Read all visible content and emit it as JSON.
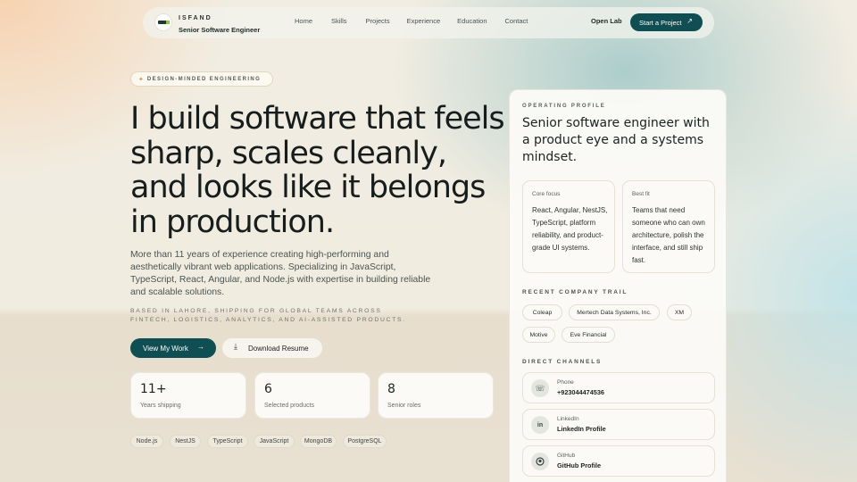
{
  "nav": {
    "brand_name": "ISFAND",
    "brand_subtitle": "Senior Software Engineer",
    "links": [
      "Home",
      "Skills",
      "Projects",
      "Experience",
      "Education",
      "Contact"
    ],
    "open_lab": "Open Lab",
    "cta": "Start a Project"
  },
  "hero": {
    "badge": "DESIGN-MINDED ENGINEERING",
    "headline": "I build software that feels sharp, scales cleanly, and looks like it belongs in production.",
    "lead": "More than 11 years of experience creating high-performing and aesthetically vibrant web applications. Specializing in JavaScript, TypeScript, React, Angular, and Node.js with expertise in building reliable and scalable solutions.",
    "based": "BASED IN LAHORE, SHIPPING FOR GLOBAL TEAMS ACROSS FINTECH, LOGISTICS, ANALYTICS, AND AI-ASSISTED PRODUCTS.",
    "primary_button": "View My Work",
    "secondary_button": "Download Resume",
    "stats": [
      {
        "value": "11+",
        "label": "Years shipping"
      },
      {
        "value": "6",
        "label": "Selected products"
      },
      {
        "value": "8",
        "label": "Senior roles"
      }
    ],
    "tech": [
      "Node.js",
      "NestJS",
      "TypeScript",
      "JavaScript",
      "MongoDB",
      "PostgreSQL"
    ]
  },
  "profile": {
    "eyebrow": "OPERATING PROFILE",
    "title": "Senior software engineer with a product eye and a systems mindset.",
    "core_focus_label": "Core focus",
    "core_focus_text": "React, Angular, NestJS, TypeScript, platform reliability, and product-grade UI systems.",
    "best_fit_label": "Best fit",
    "best_fit_text": "Teams that need someone who can own architecture, polish the interface, and still ship fast.",
    "companies_heading": "RECENT COMPANY TRAIL",
    "companies": [
      "Coleap",
      "Mertech Data Systems, Inc.",
      "XM",
      "Motive",
      "Eve Financial"
    ],
    "channels_heading": "DIRECT CHANNELS",
    "channels": [
      {
        "label": "Phone",
        "value": "+923044474536",
        "icon": "phone-icon"
      },
      {
        "label": "LinkedIn",
        "value": "LinkedIn Profile",
        "icon": "linkedin-icon"
      },
      {
        "label": "GitHub",
        "value": "GitHub Profile",
        "icon": "github-icon"
      }
    ]
  },
  "colors": {
    "accent": "#0f4e52",
    "background": "#efe9dc"
  }
}
